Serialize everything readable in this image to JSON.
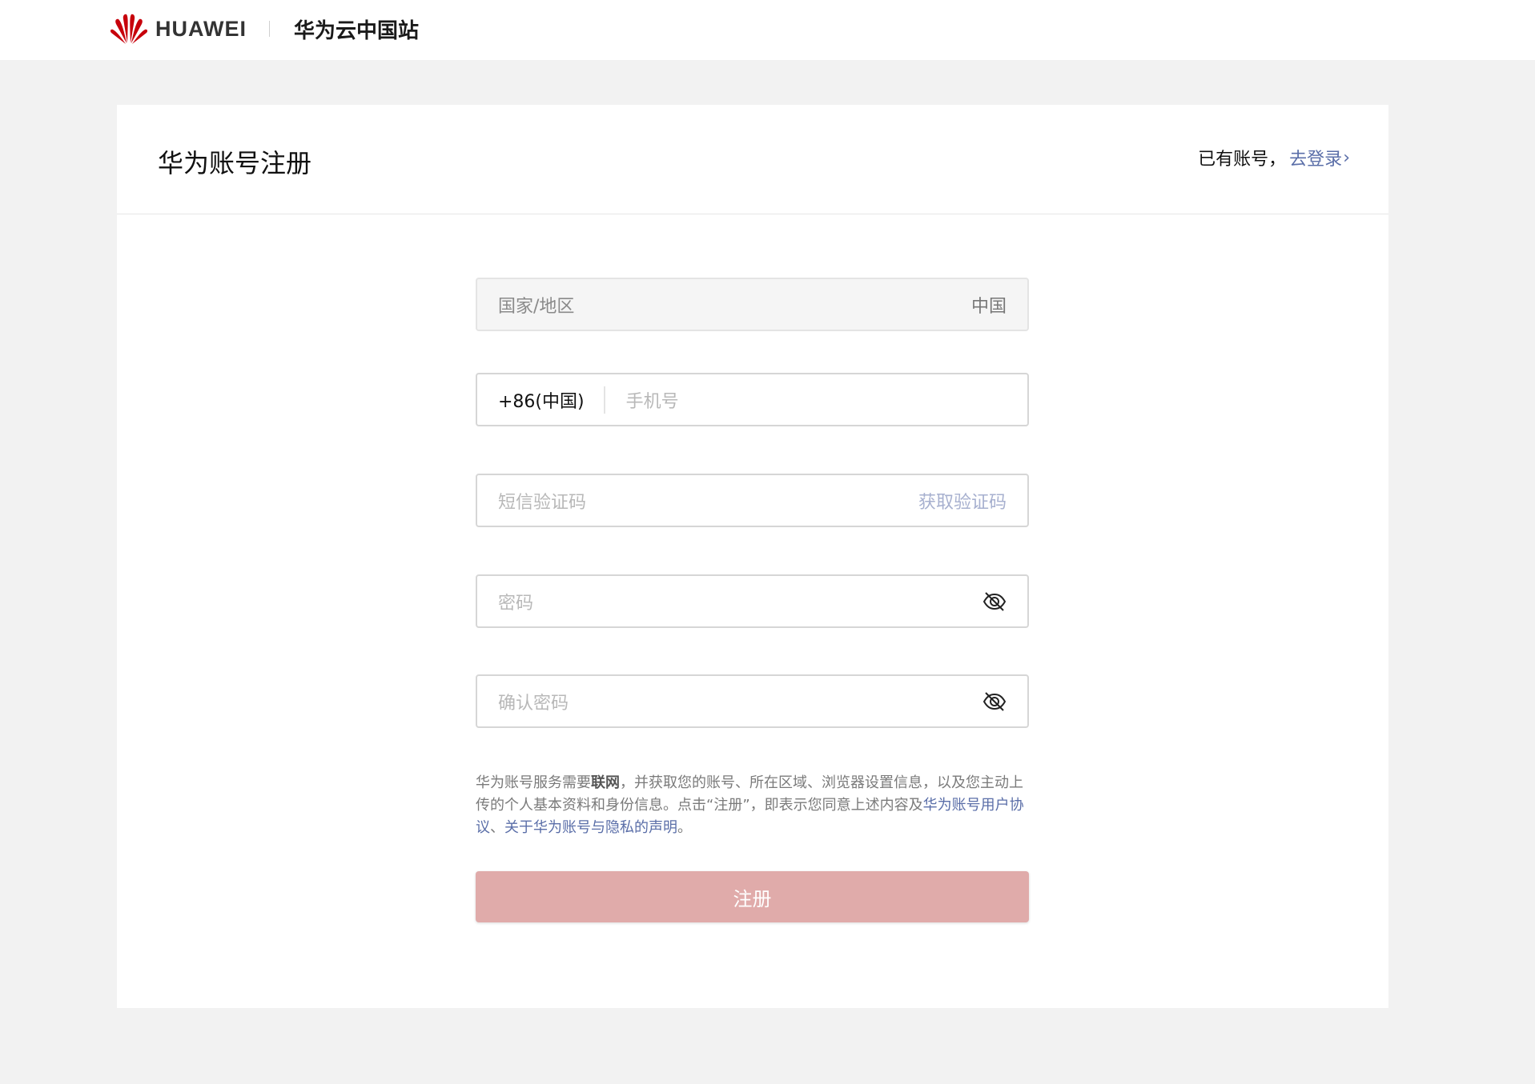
{
  "header": {
    "brand": "HUAWEI",
    "site_name": "华为云中国站"
  },
  "card": {
    "title": "华为账号注册",
    "have_account": "已有账号，",
    "login_link": "去登录",
    "login_chevron": "›"
  },
  "form": {
    "region": {
      "label": "国家/地区",
      "value": "中国"
    },
    "phone": {
      "country_code": "+86(中国)",
      "placeholder": "手机号"
    },
    "sms": {
      "placeholder": "短信验证码",
      "action": "获取验证码"
    },
    "password": {
      "placeholder": "密码",
      "icon": "eye-off-icon"
    },
    "confirm_password": {
      "placeholder": "确认密码",
      "icon": "eye-off-icon"
    }
  },
  "consent": {
    "text_1": "华为账号服务需要",
    "bold": "联网",
    "text_2": "，并获取您的账号、所在区域、浏览器设置信息，以及您主动上传的个人基本资料和身份信息。点击“注册”，即表示您同意上述内容及",
    "link_agreement": "华为账号用户协议",
    "sep": "、",
    "link_privacy": "关于华为账号与隐私的声明",
    "end": "。"
  },
  "submit_label": "注册",
  "colors": {
    "background": "#f2f2f2",
    "link": "#5a6ea8",
    "submit_disabled": "#e0abaa",
    "brand_red": "#c7000b"
  }
}
